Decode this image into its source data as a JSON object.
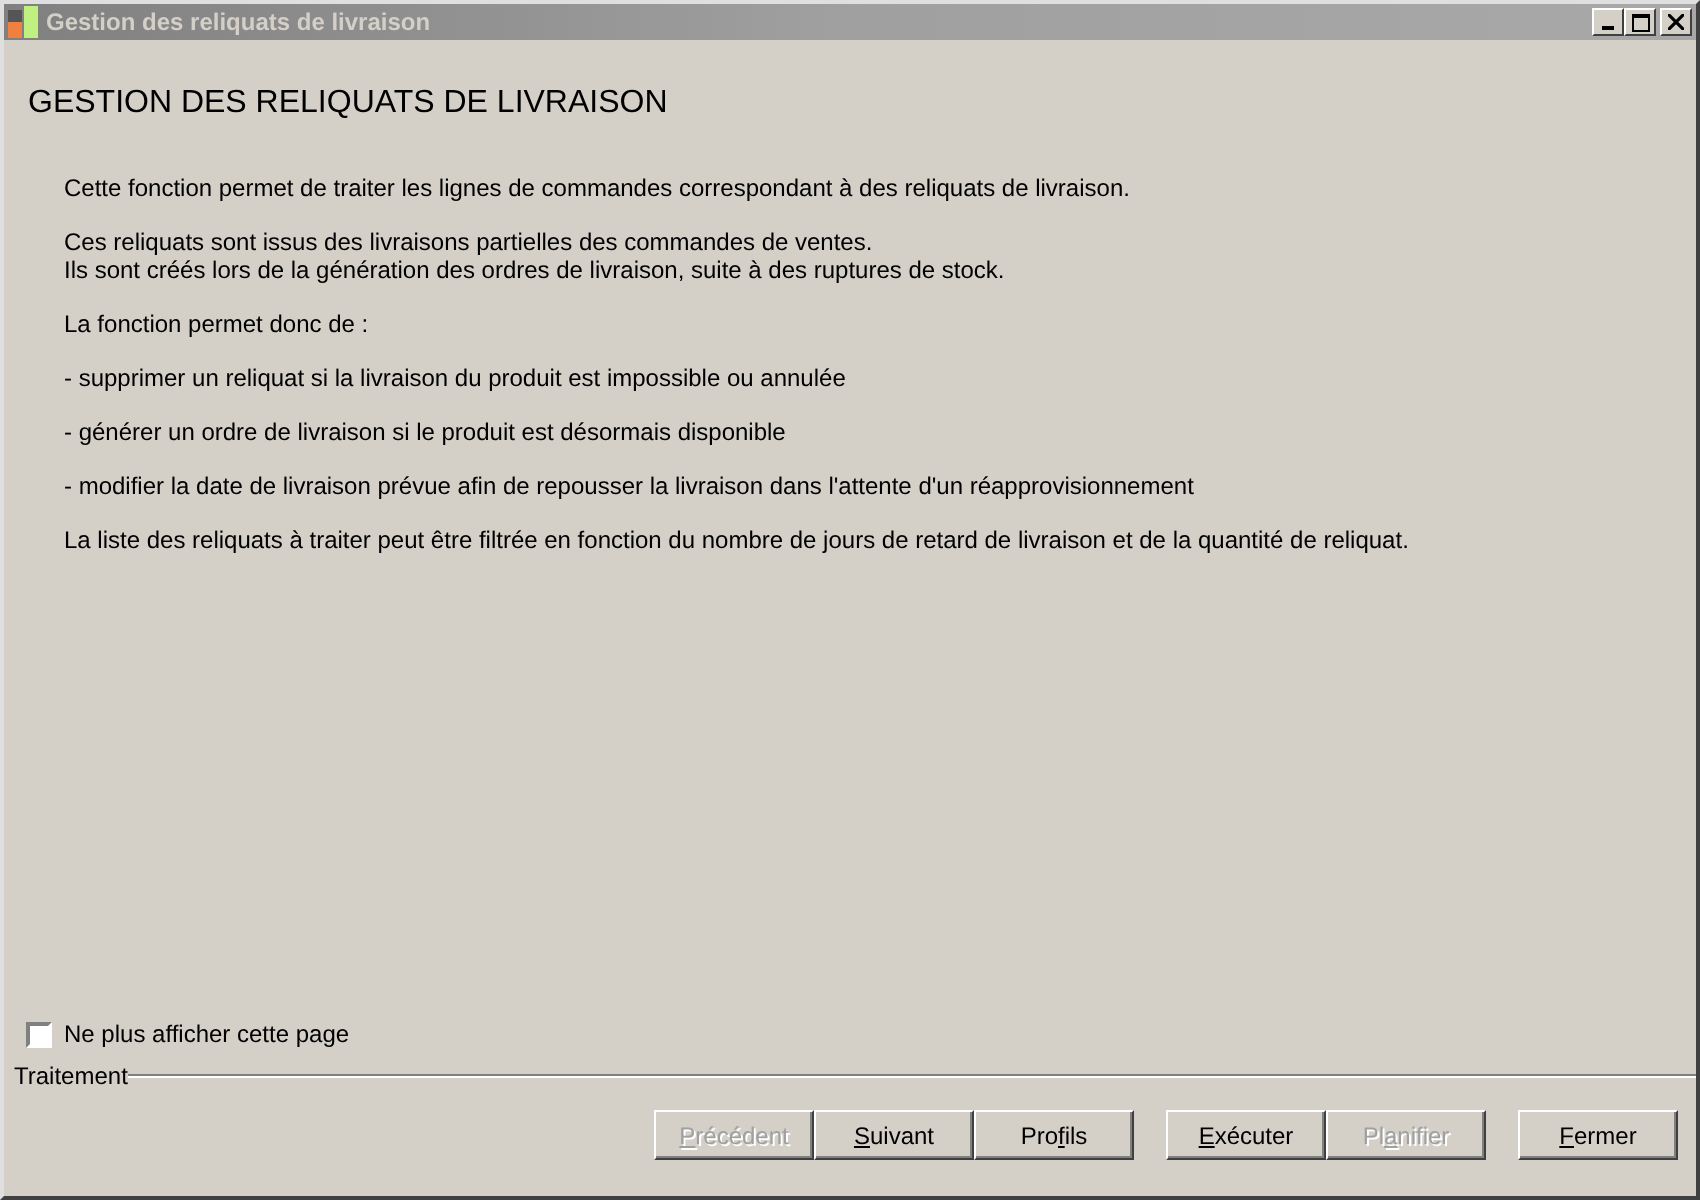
{
  "window": {
    "title": "Gestion des reliquats de livraison"
  },
  "heading": "GESTION DES RELIQUATS DE LIVRAISON",
  "paragraphs": [
    {
      "lines": [
        "Cette fonction permet de traiter les lignes de commandes correspondant à des reliquats de livraison."
      ]
    },
    {
      "lines": [
        "Ces reliquats sont issus des livraisons partielles des commandes de ventes.",
        "Ils sont créés lors de la génération des ordres de livraison, suite à des ruptures de stock."
      ]
    },
    {
      "lines": [
        "La fonction permet donc de :"
      ]
    },
    {
      "lines": [
        "- supprimer un reliquat si la livraison du produit est impossible ou annulée"
      ]
    },
    {
      "lines": [
        "- générer un ordre de livraison si le produit est désormais disponible"
      ]
    },
    {
      "lines": [
        "- modifier la date de livraison prévue afin de repousser la livraison dans l'attente d'un réapprovisionnement"
      ]
    },
    {
      "lines": [
        "La liste des reliquats à traiter peut être filtrée en fonction du nombre de jours de retard de livraison et de la quantité de reliquat."
      ]
    }
  ],
  "checkbox": {
    "label": "Ne plus afficher cette page",
    "checked": false
  },
  "group_label": "Traitement",
  "button_groups": [
    {
      "buttons": [
        {
          "access_key": "P",
          "text_after": "récédent",
          "disabled": true
        },
        {
          "access_key": "S",
          "text_after": "uivant",
          "disabled": false
        },
        {
          "text_before": "Pro",
          "access_key": "f",
          "text_after": "ils",
          "disabled": false
        }
      ]
    },
    {
      "buttons": [
        {
          "access_key": "E",
          "text_after": "xécuter",
          "disabled": false
        },
        {
          "text_before": "Pl",
          "access_key": "a",
          "text_after": "nifier",
          "disabled": true
        }
      ]
    },
    {
      "buttons": [
        {
          "access_key": "F",
          "text_after": "ermer",
          "disabled": false
        }
      ]
    }
  ]
}
